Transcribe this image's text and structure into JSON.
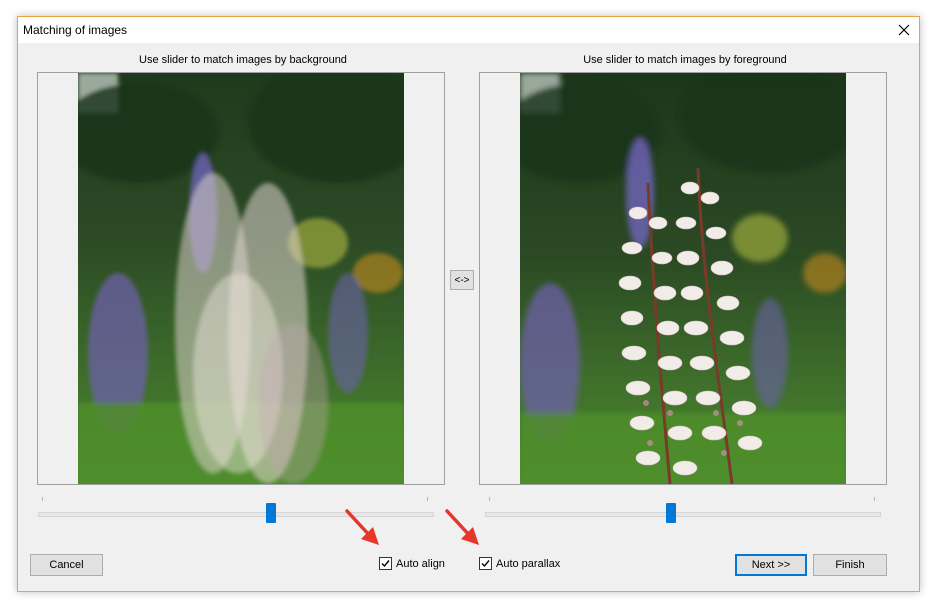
{
  "window": {
    "title": "Matching of images"
  },
  "panels": {
    "left_caption": "Use slider to match images by background",
    "right_caption": "Use slider to match images by foreground"
  },
  "swap_label": "<->",
  "sliders": {
    "left_value": 0.59,
    "right_value": 0.47
  },
  "options": {
    "auto_align": {
      "label": "Auto align",
      "checked": true
    },
    "auto_parallax": {
      "label": "Auto parallax",
      "checked": true
    }
  },
  "buttons": {
    "cancel": "Cancel",
    "next": "Next >>",
    "finish": "Finish"
  },
  "colors": {
    "accent": "#0078d7",
    "window_border": "#e8a33d",
    "annotation_arrow": "#e5362a"
  }
}
